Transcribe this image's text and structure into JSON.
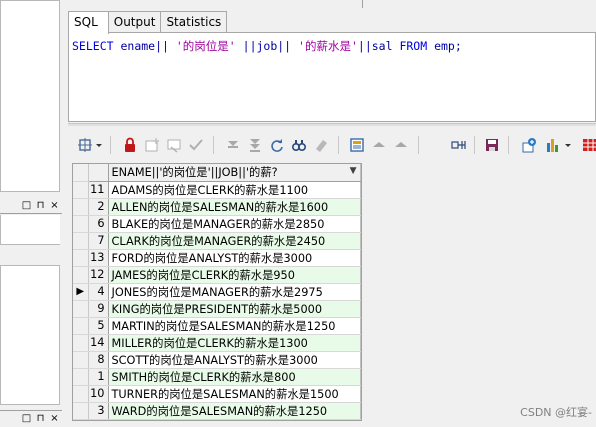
{
  "tabs": [
    {
      "label": "SQL",
      "active": true
    },
    {
      "label": "Output",
      "active": false
    },
    {
      "label": "Statistics",
      "active": false
    }
  ],
  "sql": {
    "kw_select": "SELECT",
    "expr_1": " ename|| ",
    "str_1": "'的岗位是'",
    "expr_2": " ||job|| ",
    "str_2": "'的薪水是'",
    "expr_3": "||sal ",
    "kw_from": "FROM",
    "expr_4": " emp;"
  },
  "left_panel": {
    "window_controls": [
      "□",
      "⊓",
      "×"
    ]
  },
  "toolbar": {
    "icons": [
      "query-by-example-icon",
      "dropdown-icon",
      "lock-icon",
      "insert-record-icon",
      "delete-record-icon",
      "post-changes-icon",
      "next-page-icon",
      "last-page-icon",
      "refresh-icon",
      "find-icon",
      "clear-icon",
      "single-record-view-icon",
      "previous-record-icon",
      "next-record-icon",
      "export-icon",
      "save-icon",
      "connection-icon",
      "chart-icon",
      "chart-dropdown-icon",
      "grid-icon"
    ]
  },
  "grid": {
    "column_header": "ENAME||'的岗位是'||JOB||'的薪?",
    "current_row_index": 6,
    "rows": [
      {
        "num": "11",
        "value": "ADAMS的岗位是CLERK的薪水是1100"
      },
      {
        "num": "2",
        "value": "ALLEN的岗位是SALESMAN的薪水是1600"
      },
      {
        "num": "6",
        "value": "BLAKE的岗位是MANAGER的薪水是2850"
      },
      {
        "num": "7",
        "value": "CLARK的岗位是MANAGER的薪水是2450"
      },
      {
        "num": "13",
        "value": "FORD的岗位是ANALYST的薪水是3000"
      },
      {
        "num": "12",
        "value": "JAMES的岗位是CLERK的薪水是950"
      },
      {
        "num": "4",
        "value": "JONES的岗位是MANAGER的薪水是2975"
      },
      {
        "num": "9",
        "value": "KING的岗位是PRESIDENT的薪水是5000"
      },
      {
        "num": "5",
        "value": "MARTIN的岗位是SALESMAN的薪水是1250"
      },
      {
        "num": "14",
        "value": "MILLER的岗位是CLERK的薪水是1300"
      },
      {
        "num": "8",
        "value": "SCOTT的岗位是ANALYST的薪水是3000"
      },
      {
        "num": "1",
        "value": "SMITH的岗位是CLERK的薪水是800"
      },
      {
        "num": "10",
        "value": "TURNER的岗位是SALESMAN的薪水是1500"
      },
      {
        "num": "3",
        "value": "WARD的岗位是SALESMAN的薪水是1250"
      }
    ]
  },
  "watermark": "CSDN @红宴-"
}
